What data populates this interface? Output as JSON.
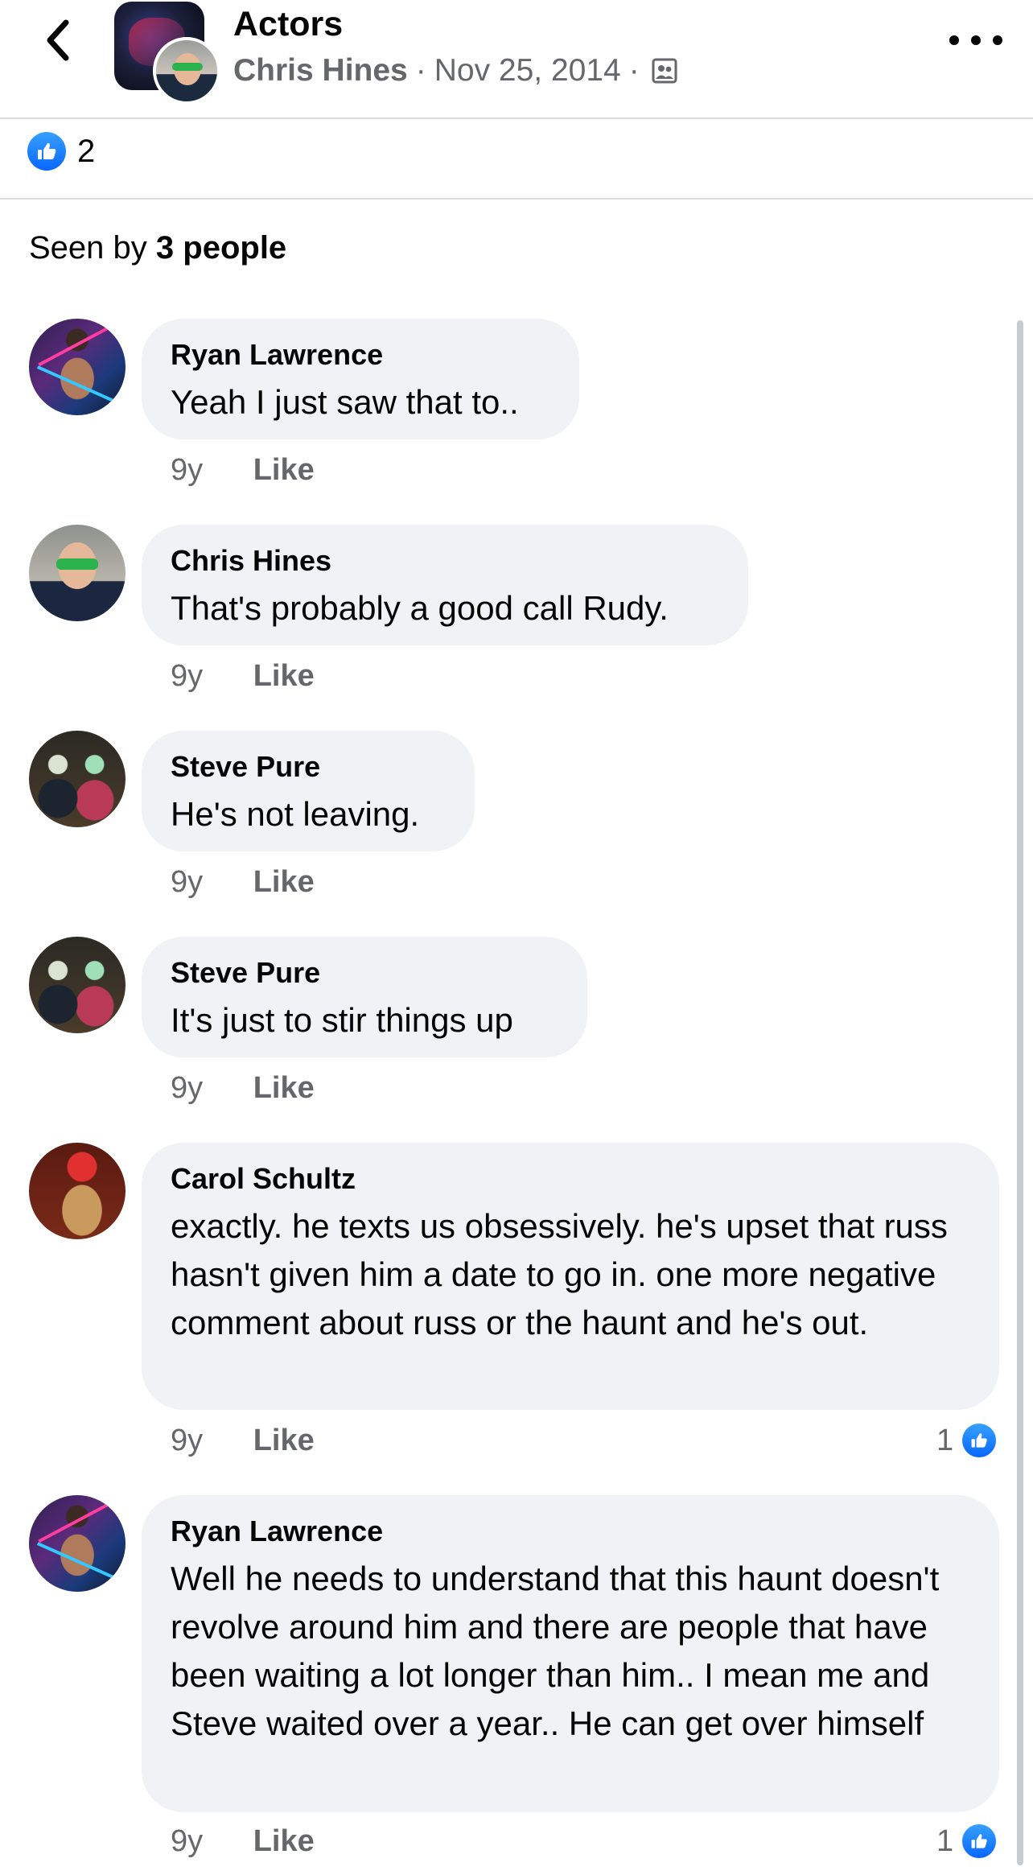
{
  "header": {
    "title": "Actors",
    "author": "Chris Hines",
    "date": "Nov 25, 2014",
    "separator": "·",
    "privacy_icon": "group-members-icon",
    "back_icon": "chevron-left-icon",
    "more_icon": "more-horizontal-icon"
  },
  "reactions": {
    "icon": "like-icon",
    "count": "2"
  },
  "seen_by": {
    "prefix": "Seen by",
    "count_text": "3 people"
  },
  "comments": [
    {
      "author": "Ryan Lawrence",
      "text": "Yeah I just saw that to..",
      "time": "9y",
      "like_label": "Like",
      "reaction_count": ""
    },
    {
      "author": "Chris Hines",
      "text": "That's probably a good call Rudy.",
      "time": "9y",
      "like_label": "Like",
      "reaction_count": ""
    },
    {
      "author": "Steve Pure",
      "text": "He's not leaving.",
      "time": "9y",
      "like_label": "Like",
      "reaction_count": ""
    },
    {
      "author": "Steve Pure",
      "text": "It's just to stir things up",
      "time": "9y",
      "like_label": "Like",
      "reaction_count": ""
    },
    {
      "author": "Carol Schultz",
      "text": "exactly.  he texts us obsessively.  he's upset that russ hasn't given him a date to go in.  one more negative comment about russ or the haunt and he's out.",
      "time": "9y",
      "like_label": "Like",
      "reaction_count": "1"
    },
    {
      "author": "Ryan Lawrence",
      "text": "Well he needs to understand that this haunt doesn't revolve around him and there are people that have been waiting a lot longer than him.. I mean me and Steve waited over a year.. He can get over himself",
      "time": "9y",
      "like_label": "Like",
      "reaction_count": "1"
    }
  ],
  "colors": {
    "accent": "#0866ff",
    "bubble": "#f0f2f5",
    "secondary_text": "#65676b",
    "divider": "#dadde1"
  }
}
